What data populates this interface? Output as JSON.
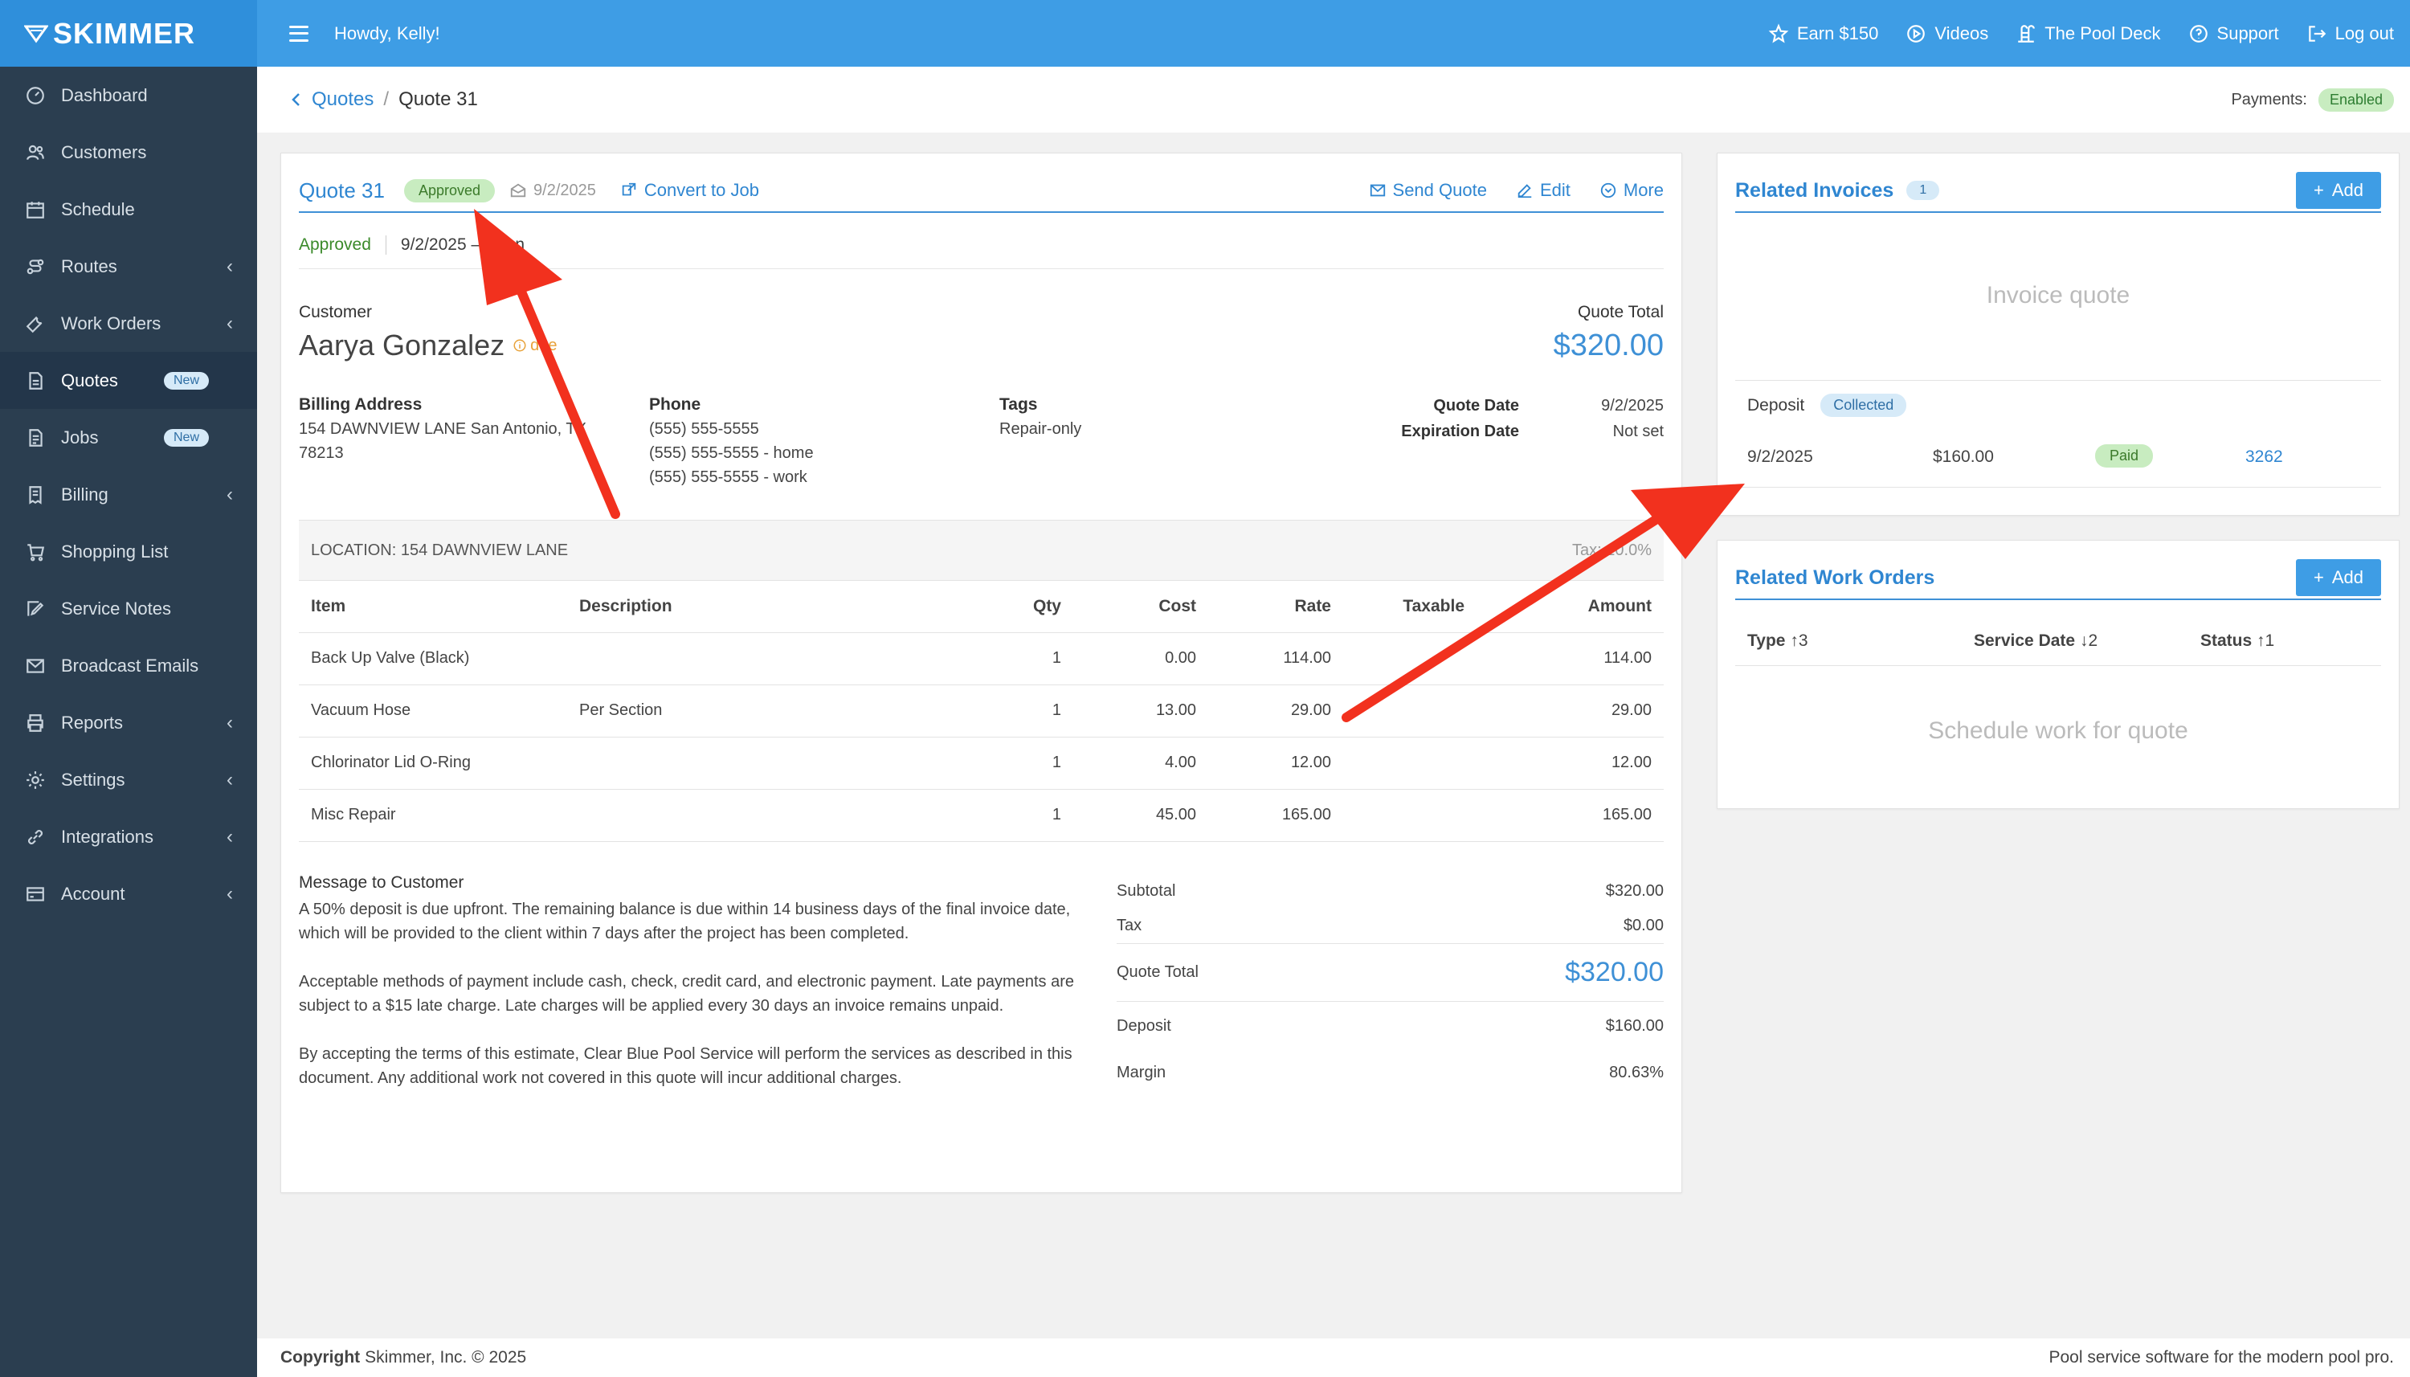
{
  "brand": {
    "name": "SKIMMER"
  },
  "topbar": {
    "greeting": "Howdy, Kelly!",
    "links": [
      {
        "label": "Earn $150",
        "icon": "star-icon"
      },
      {
        "label": "Videos",
        "icon": "play-icon"
      },
      {
        "label": "The Pool Deck",
        "icon": "pool-ladder-icon"
      },
      {
        "label": "Support",
        "icon": "help-icon"
      },
      {
        "label": "Log out",
        "icon": "logout-icon"
      }
    ]
  },
  "sidebar": {
    "items": [
      {
        "label": "Dashboard",
        "icon": "dashboard-icon"
      },
      {
        "label": "Customers",
        "icon": "users-icon"
      },
      {
        "label": "Schedule",
        "icon": "calendar-icon"
      },
      {
        "label": "Routes",
        "icon": "route-icon",
        "chevron": "‹"
      },
      {
        "label": "Work Orders",
        "icon": "wrench-icon",
        "chevron": "‹"
      },
      {
        "label": "Quotes",
        "icon": "quote-doc-icon",
        "badge": "New",
        "active": true
      },
      {
        "label": "Jobs",
        "icon": "jobs-doc-icon",
        "badge": "New"
      },
      {
        "label": "Billing",
        "icon": "billing-icon",
        "chevron": "‹"
      },
      {
        "label": "Shopping List",
        "icon": "cart-icon"
      },
      {
        "label": "Service Notes",
        "icon": "note-edit-icon"
      },
      {
        "label": "Broadcast Emails",
        "icon": "mail-icon"
      },
      {
        "label": "Reports",
        "icon": "printer-icon",
        "chevron": "‹"
      },
      {
        "label": "Settings",
        "icon": "gear-icon",
        "chevron": "‹"
      },
      {
        "label": "Integrations",
        "icon": "link-icon",
        "chevron": "‹"
      },
      {
        "label": "Account",
        "icon": "account-card-icon",
        "chevron": "‹"
      }
    ]
  },
  "breadcrumb": {
    "parent": "Quotes",
    "separator": "/",
    "current": "Quote 31"
  },
  "payments": {
    "label": "Payments:",
    "status": "Enabled"
  },
  "quote": {
    "title": "Quote 31",
    "status_badge": "Approved",
    "sent_date": "9/2/2025",
    "convert_label": "Convert to Job",
    "send_label": "Send Quote",
    "edit_label": "Edit",
    "more_label": "More",
    "status_text": "Approved",
    "status_detail": "9/2/2025 – Ryan",
    "customer_label": "Customer",
    "customer_name": "Aarya Gonzalez",
    "customer_due": "due",
    "total_label": "Quote Total",
    "total_value": "$320.00",
    "billing_label": "Billing Address",
    "billing_line1": "154 DAWNVIEW LANE San Antonio, TX",
    "billing_line2": "78213",
    "phone_label": "Phone",
    "phones": [
      "(555) 555-5555",
      "(555) 555-5555 - home",
      "(555) 555-5555 - work"
    ],
    "tags_label": "Tags",
    "tags_value": "Repair-only",
    "quote_date_label": "Quote Date",
    "quote_date": "9/2/2025",
    "expiration_label": "Expiration Date",
    "expiration_value": "Not set",
    "location": "LOCATION: 154 DAWNVIEW LANE",
    "tax_note": "Tax: 10.0%",
    "columns": [
      "Item",
      "Description",
      "Qty",
      "Cost",
      "Rate",
      "Taxable",
      "Amount"
    ],
    "items": [
      {
        "item": "Back Up Valve (Black)",
        "desc": "",
        "qty": "1",
        "cost": "0.00",
        "rate": "114.00",
        "taxable": "",
        "amount": "114.00"
      },
      {
        "item": "Vacuum Hose",
        "desc": "Per Section",
        "qty": "1",
        "cost": "13.00",
        "rate": "29.00",
        "taxable": "",
        "amount": "29.00"
      },
      {
        "item": "Chlorinator Lid O-Ring",
        "desc": "",
        "qty": "1",
        "cost": "4.00",
        "rate": "12.00",
        "taxable": "",
        "amount": "12.00"
      },
      {
        "item": "Misc Repair",
        "desc": "",
        "qty": "1",
        "cost": "45.00",
        "rate": "165.00",
        "taxable": "",
        "amount": "165.00"
      }
    ],
    "message_label": "Message to Customer",
    "message": [
      "A 50% deposit is due upfront. The remaining balance is due within 14 business days of the final invoice date, which will be provided to the client within 7 days after the project has been completed.",
      "Acceptable methods of payment include cash, check, credit card, and electronic payment. Late payments are subject to a $15 late charge. Late charges will be applied every 30 days an invoice remains unpaid.",
      "By accepting the terms of this estimate, Clear Blue Pool Service will perform the services as described in this document. Any additional work not covered in this quote will incur additional charges."
    ],
    "subtotal_label": "Subtotal",
    "subtotal": "$320.00",
    "tax_label": "Tax",
    "tax": "$0.00",
    "total2_label": "Quote Total",
    "total2": "$320.00",
    "deposit_label": "Deposit",
    "deposit": "$160.00",
    "margin_label": "Margin",
    "margin": "80.63%"
  },
  "invoices": {
    "title": "Related Invoices",
    "count": "1",
    "add_label": "Add",
    "empty": "Invoice quote",
    "deposit_label": "Deposit",
    "deposit_status": "Collected",
    "row": {
      "date": "9/2/2025",
      "amount": "$160.00",
      "status": "Paid",
      "number": "3262"
    }
  },
  "work_orders": {
    "title": "Related Work Orders",
    "add_label": "Add",
    "columns": [
      {
        "label": "Type",
        "sort": "↑3"
      },
      {
        "label": "Service Date",
        "sort": "↓2"
      },
      {
        "label": "Status",
        "sort": "↑1"
      }
    ],
    "empty": "Schedule work for quote"
  },
  "footer": {
    "copyright_label": "Copyright",
    "copyright_text": "Skimmer, Inc. © 2025",
    "tagline": "Pool service software for the modern pool pro."
  },
  "colors": {
    "accent": "#3e9de5",
    "sidebar": "#2b3e50",
    "annotation": "#f2311e"
  }
}
